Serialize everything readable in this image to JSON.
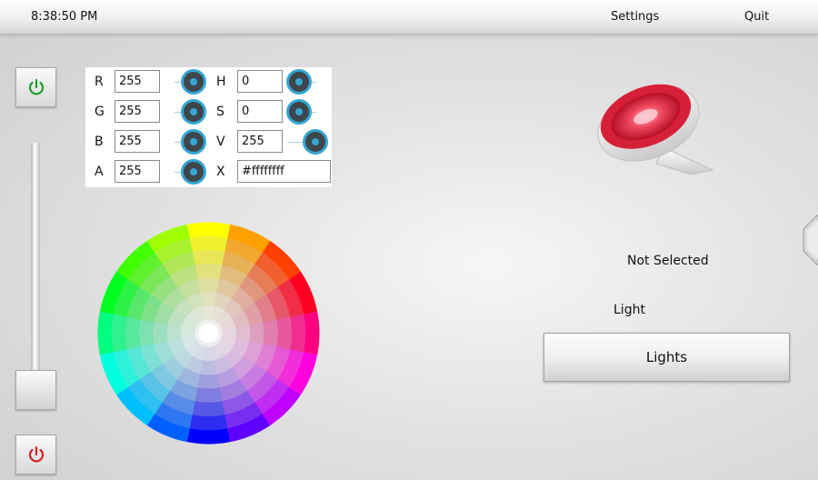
{
  "topbar": {
    "time": "8:38:50 PM",
    "settings_label": "Settings",
    "quit_label": "Quit"
  },
  "power": {
    "on_icon": "power-icon",
    "on_color": "#1f9d2b",
    "off_icon": "power-icon",
    "off_color": "#d62020"
  },
  "color_panel": {
    "r_label": "R",
    "r_value": "255",
    "g_label": "G",
    "g_value": "255",
    "b_label": "B",
    "b_value": "255",
    "a_label": "A",
    "a_value": "255",
    "h_label": "H",
    "h_value": "0",
    "s_label": "S",
    "s_value": "0",
    "v_label": "V",
    "v_value": "255",
    "x_label": "X",
    "x_value": "#ffffffff",
    "knob_color": "#35a6d4"
  },
  "device": {
    "status": "Not Selected",
    "light_label": "Light",
    "lights_button": "Lights",
    "lamp_color": "#e8283f"
  }
}
